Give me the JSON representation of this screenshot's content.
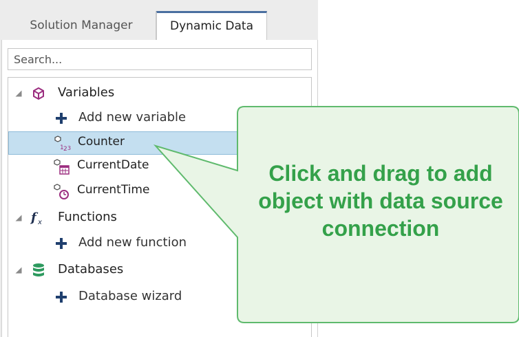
{
  "tabs": [
    {
      "label": "Solution Manager",
      "active": false
    },
    {
      "label": "Dynamic Data",
      "active": true
    }
  ],
  "search": {
    "placeholder": "Search..."
  },
  "tree": {
    "variables": {
      "label": "Variables",
      "add_label": "Add new variable",
      "items": [
        {
          "label": "Counter",
          "icon": "counter-variable-icon",
          "selected": true
        },
        {
          "label": "CurrentDate",
          "icon": "date-variable-icon",
          "selected": false
        },
        {
          "label": "CurrentTime",
          "icon": "time-variable-icon",
          "selected": false
        }
      ]
    },
    "functions": {
      "label": "Functions",
      "add_label": "Add new function"
    },
    "databases": {
      "label": "Databases",
      "add_label": "Database wizard"
    }
  },
  "callout": {
    "text": "Click and drag to add\nobject with data source\nconnection",
    "color": "#34a14a",
    "fill": "#e9f5e6",
    "border": "#5fba6d"
  }
}
